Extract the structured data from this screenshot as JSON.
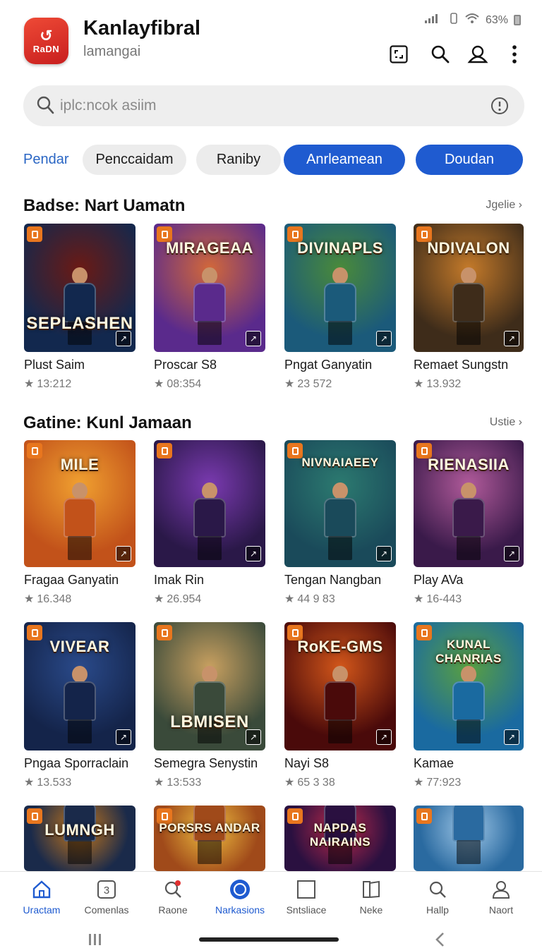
{
  "status": {
    "battery": "63%"
  },
  "app": {
    "logo_text": "RaDN",
    "title": "Kanlayfibral",
    "subtitle": "lamangai"
  },
  "header_icons": [
    "qr-scan-icon",
    "search-icon",
    "profile-icon",
    "more-vert-icon"
  ],
  "search": {
    "placeholder": "iplc:ncok asiim"
  },
  "filters": {
    "first": "Pendar",
    "chips": [
      {
        "label": "Penccaidam",
        "style": "light"
      },
      {
        "label": "Raniby",
        "style": "light"
      },
      {
        "label": "Anrleamean",
        "style": "dark"
      },
      {
        "label": "Doudan",
        "style": "dark"
      }
    ]
  },
  "sections": [
    {
      "title": "Badse: Nart Uamatn",
      "see_more": "Jgelie",
      "games": [
        {
          "name": "Plust Saim",
          "rating": "13:212",
          "art_text": "SEPLASHEN",
          "colors": [
            "#12284e",
            "#6b1a14"
          ]
        },
        {
          "name": "Proscar S8",
          "rating": "08:354",
          "art_text": "MIRAGEAA",
          "colors": [
            "#5a2a8c",
            "#d2683a"
          ]
        },
        {
          "name": "Pngat Ganyatin",
          "rating": "23 572",
          "art_text": "DIVINAPLS",
          "colors": [
            "#1b5a7a",
            "#4a8a3a"
          ]
        },
        {
          "name": "Remaet Sungstn",
          "rating": "13.932",
          "art_text": "NDIVALON",
          "colors": [
            "#3e2c1a",
            "#c47a2a"
          ]
        }
      ]
    },
    {
      "title": "Gatine: Kunl Jamaan",
      "see_more": "Ustie",
      "games": [
        {
          "name": "Fragaa Ganyatin",
          "rating": "16.348",
          "art_text": "MILE",
          "colors": [
            "#c2521a",
            "#f0a030"
          ]
        },
        {
          "name": "Imak Rin",
          "rating": "26.954",
          "art_text": "",
          "colors": [
            "#2a1848",
            "#7a3ab0"
          ]
        },
        {
          "name": "Tengan Nangban",
          "rating": "44 9 83",
          "art_text": "NIVNAIAEEY",
          "colors": [
            "#1a4a5a",
            "#2c7a70"
          ]
        },
        {
          "name": "Play AVa",
          "rating": "16-443",
          "art_text": "RIENASIIA",
          "colors": [
            "#3a1a4a",
            "#b05a9a"
          ]
        }
      ]
    },
    {
      "title": "",
      "see_more": "",
      "games": [
        {
          "name": "Pngaa Sporraclain",
          "rating": "13.533",
          "art_text": "VIVEAR",
          "colors": [
            "#14244a",
            "#2a4a8a"
          ]
        },
        {
          "name": "Semegra Senystin",
          "rating": "13:533",
          "art_text": "LBMISEN",
          "colors": [
            "#3a4a3a",
            "#c8a060"
          ]
        },
        {
          "name": "Nayi S8",
          "rating": "65 3 38",
          "art_text": "RoKE-GMS",
          "colors": [
            "#4a0a0a",
            "#d2561a"
          ]
        },
        {
          "name": "Kamae",
          "rating": "77:923",
          "art_text": "KUNAL CHANRIAS",
          "colors": [
            "#1a6aa0",
            "#5aa040"
          ]
        }
      ]
    },
    {
      "title": "",
      "see_more": "",
      "games": [
        {
          "name": "",
          "rating": "",
          "art_text": "LUMNGH",
          "colors": [
            "#1a2a4a",
            "#c8781a"
          ]
        },
        {
          "name": "",
          "rating": "",
          "art_text": "PORSRS ANDAR",
          "colors": [
            "#a04a1a",
            "#f0c040"
          ]
        },
        {
          "name": "",
          "rating": "",
          "art_text": "NAPDAS NAIRAINS",
          "colors": [
            "#2a1040",
            "#c02a4a"
          ]
        },
        {
          "name": "",
          "rating": "",
          "art_text": "",
          "colors": [
            "#2a6aa0",
            "#a0c8e8"
          ]
        }
      ]
    }
  ],
  "bottom_nav": [
    {
      "label": "Uractam",
      "icon": "home-icon",
      "active": true
    },
    {
      "label": "Comenlas",
      "icon": "number-3-icon",
      "active": false
    },
    {
      "label": "Raone",
      "icon": "search-notify-icon",
      "active": false
    },
    {
      "label": "Narkasions",
      "icon": "circle-icon",
      "active": true
    },
    {
      "label": "Sntsliace",
      "icon": "square-icon",
      "active": false
    },
    {
      "label": "Neke",
      "icon": "book-icon",
      "active": false
    },
    {
      "label": "Hallp",
      "icon": "search-icon",
      "active": false
    },
    {
      "label": "Naort",
      "icon": "person-icon",
      "active": false
    }
  ],
  "colors": {
    "accent": "#1f5bd0",
    "brand": "#d9322a",
    "chip_bg": "#ececec"
  }
}
